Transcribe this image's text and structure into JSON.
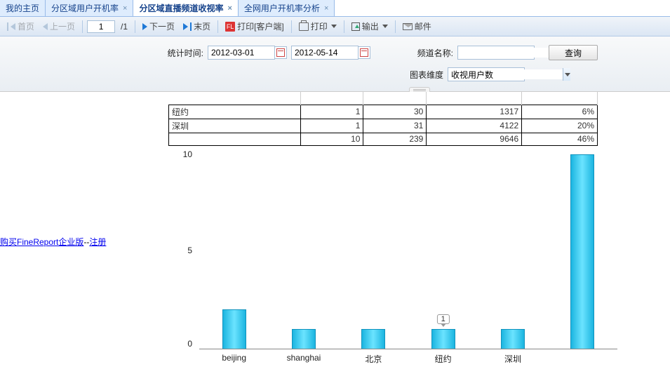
{
  "tabs": [
    {
      "label": "我的主页",
      "closable": false
    },
    {
      "label": "分区域用户开机率",
      "closable": true
    },
    {
      "label": "分区域直播频道收视率",
      "closable": true
    },
    {
      "label": "全网用户开机率分析",
      "closable": true
    }
  ],
  "toolbar": {
    "first": "首页",
    "prev": "上一页",
    "page_value": "1",
    "page_total": "/1",
    "next": "下一页",
    "last": "末页",
    "print_client": "打印[客户端]",
    "print": "打印",
    "export": "输出",
    "mail": "邮件"
  },
  "filters": {
    "time_label": "统计时间:",
    "date_from": "2012-03-01",
    "date_to": "2012-05-14",
    "channel_label": "频道名称:",
    "channel_value": "",
    "query_btn": "查询",
    "dim_label": "图表维度",
    "dim_value": "收视用户数"
  },
  "table": {
    "rows": [
      {
        "c1": "纽约",
        "c2": "1",
        "c3": "30",
        "c4": "1317",
        "c5": "6%"
      },
      {
        "c1": "深圳",
        "c2": "1",
        "c3": "31",
        "c4": "4122",
        "c5": "20%"
      },
      {
        "c1": "",
        "c2": "10",
        "c3": "239",
        "c4": "9646",
        "c5": "46%"
      }
    ]
  },
  "chart_data": {
    "type": "bar",
    "categories": [
      "beijing",
      "shanghai",
      "北京",
      "纽约",
      "深圳",
      ""
    ],
    "values": [
      2,
      1,
      1,
      1,
      1,
      10
    ],
    "tooltip_index": 3,
    "tooltip_value": "1",
    "ylim": [
      0,
      10
    ],
    "yticks": [
      0,
      5,
      10
    ],
    "title": "",
    "xlabel": "",
    "ylabel": ""
  },
  "sidebar": {
    "buy_text": "购买FineReport企业版",
    "dash": "--",
    "reg_text": "注册"
  }
}
